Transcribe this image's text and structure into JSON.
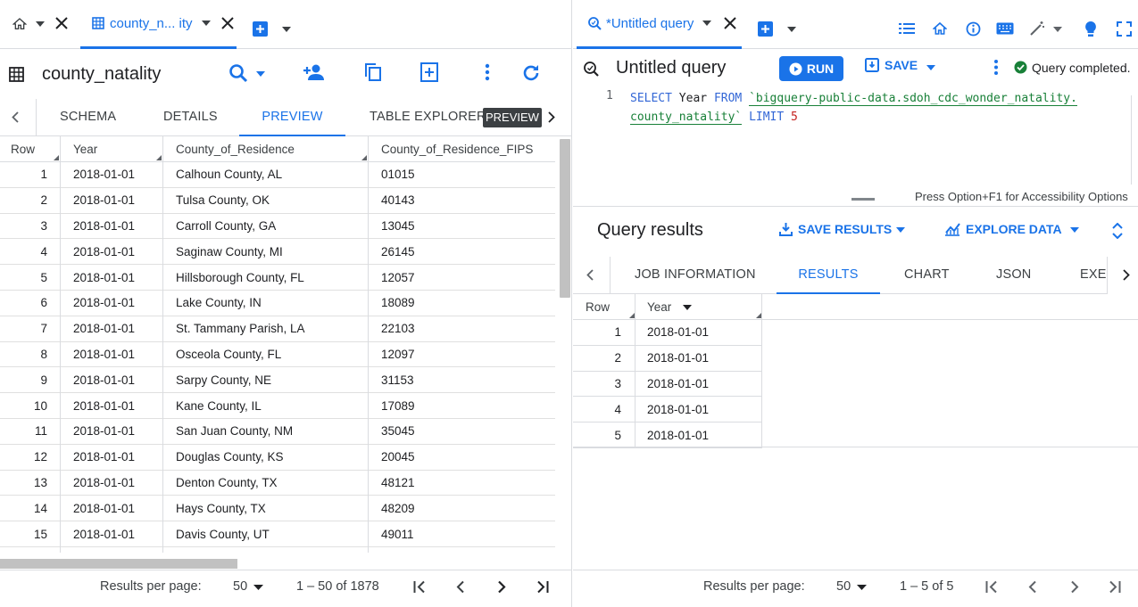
{
  "left": {
    "tabs": {
      "active_label": "county_n... ity"
    },
    "title": "county_natality",
    "subtabs": [
      "SCHEMA",
      "DETAILS",
      "PREVIEW",
      "TABLE EXPLORER"
    ],
    "tooltip": "PREVIEW",
    "table": {
      "headers": [
        "Row",
        "Year",
        "County_of_Residence",
        "County_of_Residence_FIPS"
      ],
      "rows": [
        [
          "1",
          "2018-01-01",
          "Calhoun County, AL",
          "01015"
        ],
        [
          "2",
          "2018-01-01",
          "Tulsa County, OK",
          "40143"
        ],
        [
          "3",
          "2018-01-01",
          "Carroll County, GA",
          "13045"
        ],
        [
          "4",
          "2018-01-01",
          "Saginaw County, MI",
          "26145"
        ],
        [
          "5",
          "2018-01-01",
          "Hillsborough County, FL",
          "12057"
        ],
        [
          "6",
          "2018-01-01",
          "Lake County, IN",
          "18089"
        ],
        [
          "7",
          "2018-01-01",
          "St. Tammany Parish, LA",
          "22103"
        ],
        [
          "8",
          "2018-01-01",
          "Osceola County, FL",
          "12097"
        ],
        [
          "9",
          "2018-01-01",
          "Sarpy County, NE",
          "31153"
        ],
        [
          "10",
          "2018-01-01",
          "Kane County, IL",
          "17089"
        ],
        [
          "11",
          "2018-01-01",
          "San Juan County, NM",
          "35045"
        ],
        [
          "12",
          "2018-01-01",
          "Douglas County, KS",
          "20045"
        ],
        [
          "13",
          "2018-01-01",
          "Denton County, TX",
          "48121"
        ],
        [
          "14",
          "2018-01-01",
          "Hays County, TX",
          "48209"
        ],
        [
          "15",
          "2018-01-01",
          "Davis County, UT",
          "49011"
        ]
      ]
    },
    "footer": {
      "per_page_label": "Results per page:",
      "per_page_value": "50",
      "range": "1 – 50 of 1878"
    }
  },
  "right": {
    "tab_label": "*Untitled query",
    "title": "Untitled query",
    "run_label": "RUN",
    "save_label": "SAVE",
    "status": "Query completed.",
    "editor": {
      "line_no": "1",
      "kw_select": "SELECT",
      "col": "Year",
      "kw_from": "FROM",
      "table_part1": "`bigquery-public-data.sdoh_cdc_wonder_natality.",
      "table_part2": "county_natality`",
      "kw_limit": "LIMIT",
      "limit_val": "5",
      "a11y_hint": "Press Option+F1 for Accessibility Options"
    },
    "results": {
      "heading": "Query results",
      "save_results_label": "SAVE RESULTS",
      "explore_label": "EXPLORE DATA",
      "subtabs": [
        "JOB INFORMATION",
        "RESULTS",
        "CHART",
        "JSON",
        "EXEC"
      ],
      "headers": [
        "Row",
        "Year"
      ],
      "rows": [
        [
          "1",
          "2018-01-01"
        ],
        [
          "2",
          "2018-01-01"
        ],
        [
          "3",
          "2018-01-01"
        ],
        [
          "4",
          "2018-01-01"
        ],
        [
          "5",
          "2018-01-01"
        ]
      ]
    },
    "footer": {
      "per_page_label": "Results per page:",
      "per_page_value": "50",
      "range": "1 – 5 of 5"
    }
  },
  "colors": {
    "accent": "#1a73e8",
    "success": "#188038",
    "tooltip_bg": "#3c4043"
  }
}
